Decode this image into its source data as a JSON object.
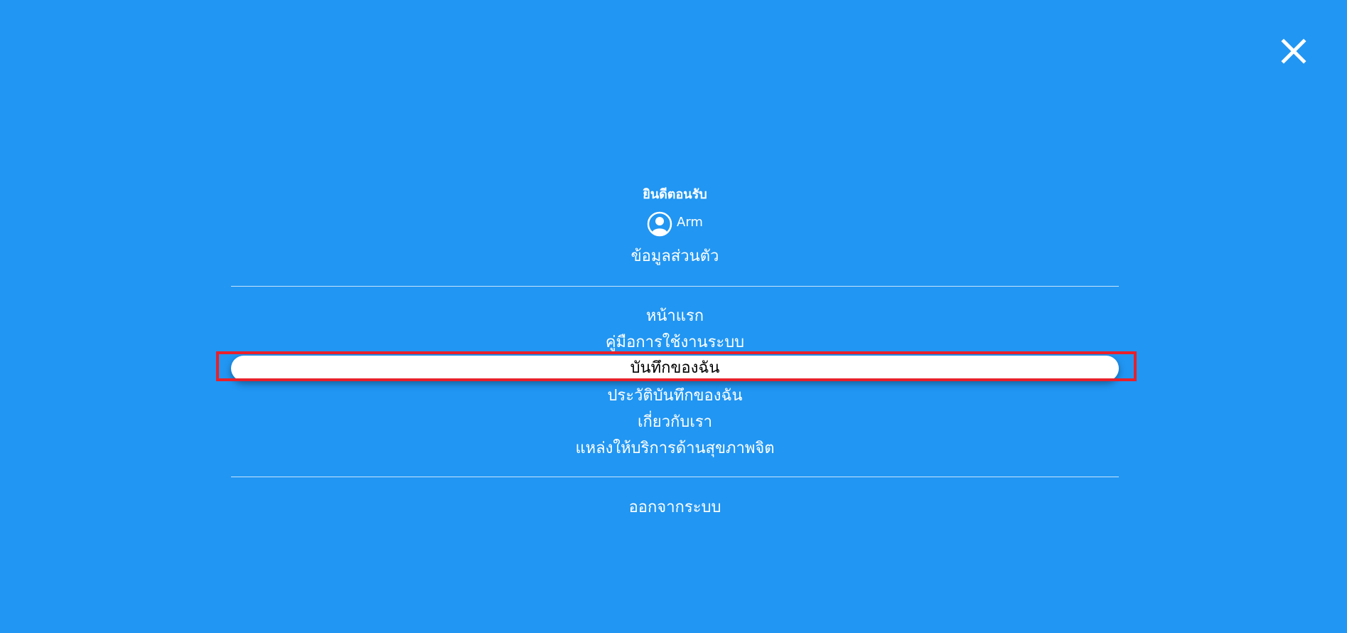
{
  "theme": {
    "background": "#2196f3",
    "text": "#ffffff",
    "active_background": "#ffffff",
    "active_text": "#000000",
    "highlight_frame": "#e8202a"
  },
  "header": {
    "close_icon": "close-icon"
  },
  "user": {
    "welcome": "ยินดีตอนรับ",
    "avatar_icon": "user-circle-icon",
    "name": "Arm",
    "profile_link": "ข้อมูลส่วนตัว"
  },
  "nav": {
    "items": [
      {
        "label": "หน้าแรก"
      },
      {
        "label": "คู่มือการใช้งานระบบ"
      },
      {
        "label": "บันทึกของฉัน",
        "active": true
      },
      {
        "label": "ประวัติบันทึกของฉัน"
      },
      {
        "label": "เกี่ยวกับเรา"
      },
      {
        "label": "แหล่งให้บริการด้านสุขภาพจิต"
      }
    ]
  },
  "footer": {
    "logout": "ออกจากระบบ"
  }
}
